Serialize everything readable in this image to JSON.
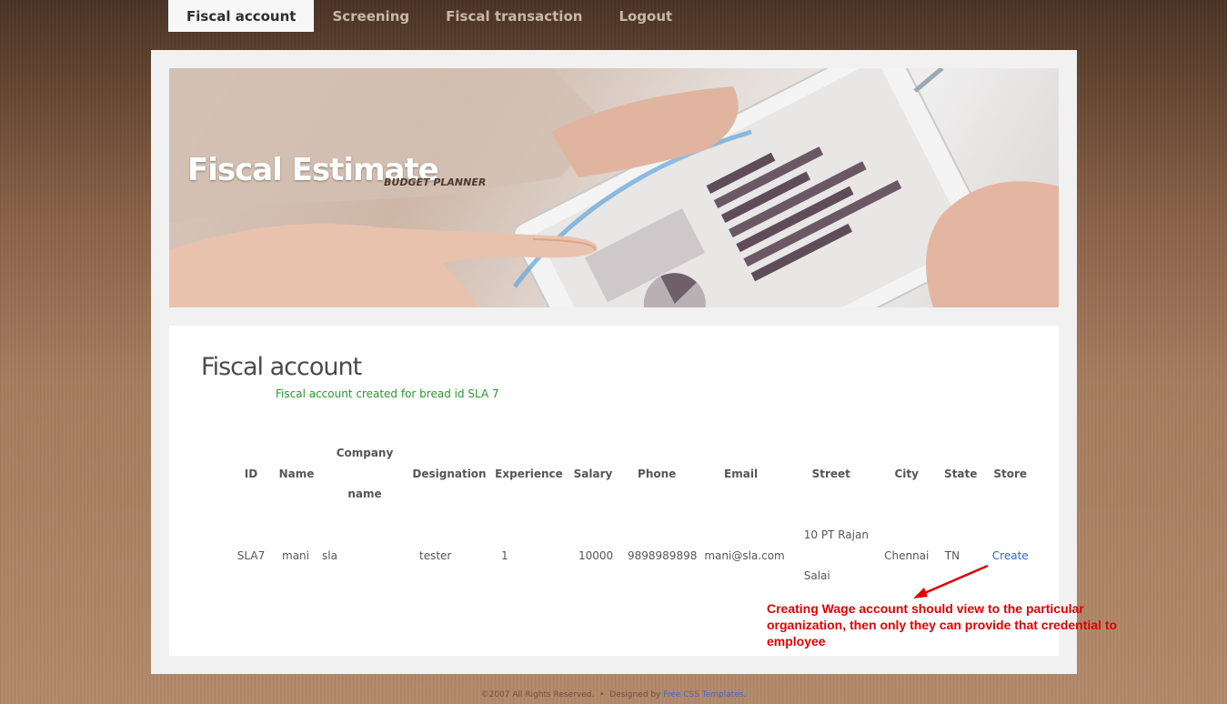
{
  "nav": {
    "items": [
      "Fiscal account",
      "Screening",
      "Fiscal transaction",
      "Logout"
    ],
    "active": "Fiscal account"
  },
  "banner": {
    "title": "Fiscal Estimate",
    "subtitle": "BUDGET PLANNER"
  },
  "main": {
    "title": "Fiscal account",
    "message": "Fiscal account created for bread id SLA 7",
    "table": {
      "headers": [
        "ID",
        "Name",
        "Company name",
        "Designation",
        "Experience",
        "Salary",
        "Phone",
        "Email",
        "Street",
        "City",
        "State",
        "Store"
      ],
      "rows": [
        {
          "id": "SLA7",
          "name": "mani",
          "company": "sla",
          "designation": "tester",
          "experience": "1",
          "salary": "10000",
          "phone": "9898989898",
          "email": "mani@sla.com",
          "street": "10 PT Rajan Salai",
          "city": "Chennai",
          "state": "TN",
          "store_link": "Create"
        }
      ]
    }
  },
  "annotation": {
    "text": "Creating Wage account should view to the particular organization, then only they can provide that credential to employee",
    "color": "#e00000"
  },
  "footer": {
    "copyright": "©2007 All Rights Reserved.",
    "separator": "•",
    "designed_by": "Designed by",
    "link": "Free CSS Templates",
    "end": "."
  },
  "colors": {
    "link": "#2a6bb5",
    "success": "#27962f",
    "active_tab_bg": "#f7f7f7"
  }
}
